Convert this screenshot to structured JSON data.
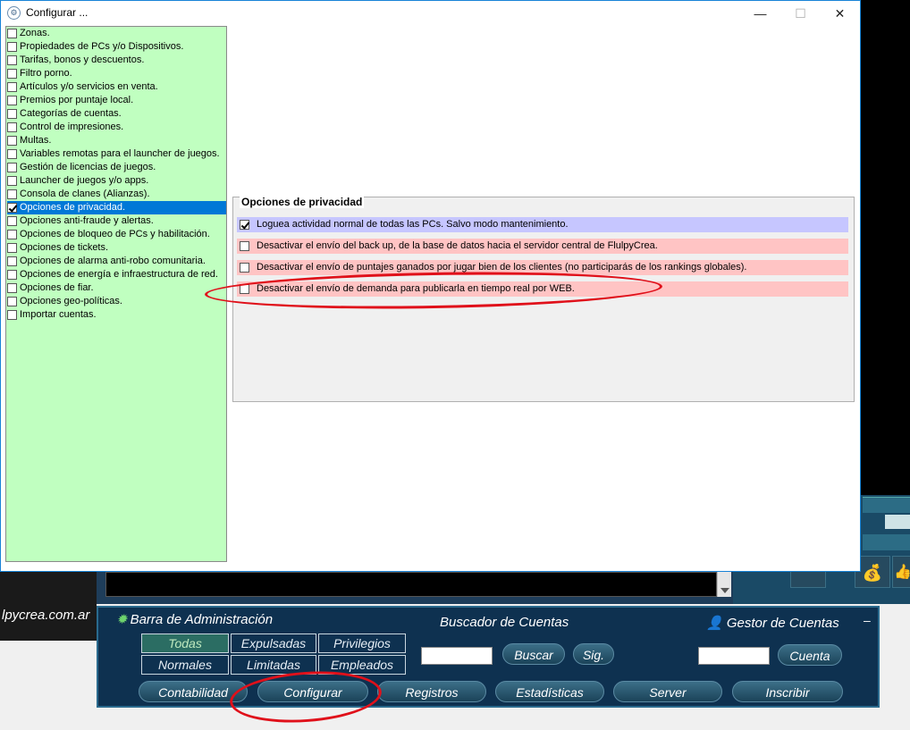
{
  "dialog": {
    "title": "Configurar ...",
    "window_buttons": {
      "minimize": "—",
      "maximize": "☐",
      "close": "✕"
    }
  },
  "tree": {
    "items": [
      {
        "label": "Zonas.",
        "checked": false,
        "selected": false
      },
      {
        "label": "Propiedades de PCs y/o Dispositivos.",
        "checked": false,
        "selected": false
      },
      {
        "label": "Tarifas, bonos y descuentos.",
        "checked": false,
        "selected": false
      },
      {
        "label": "Filtro porno.",
        "checked": false,
        "selected": false
      },
      {
        "label": "Artículos y/o servicios en venta.",
        "checked": false,
        "selected": false
      },
      {
        "label": "Premios por puntaje local.",
        "checked": false,
        "selected": false
      },
      {
        "label": "Categorías de cuentas.",
        "checked": false,
        "selected": false
      },
      {
        "label": "Control de impresiones.",
        "checked": false,
        "selected": false
      },
      {
        "label": "Multas.",
        "checked": false,
        "selected": false
      },
      {
        "label": "Variables remotas para el launcher de juegos.",
        "checked": false,
        "selected": false
      },
      {
        "label": "Gestión de licencias de juegos.",
        "checked": false,
        "selected": false
      },
      {
        "label": "Launcher de juegos y/o apps.",
        "checked": false,
        "selected": false
      },
      {
        "label": "Consola de clanes (Alianzas).",
        "checked": false,
        "selected": false
      },
      {
        "label": "Opciones de privacidad.",
        "checked": true,
        "selected": true
      },
      {
        "label": "Opciones anti-fraude y alertas.",
        "checked": false,
        "selected": false
      },
      {
        "label": "Opciones de bloqueo de PCs y habilitación.",
        "checked": false,
        "selected": false
      },
      {
        "label": "Opciones de tickets.",
        "checked": false,
        "selected": false
      },
      {
        "label": "Opciones de alarma anti-robo comunitaria.",
        "checked": false,
        "selected": false
      },
      {
        "label": "Opciones de energía e infraestructura de red.",
        "checked": false,
        "selected": false
      },
      {
        "label": "Opciones de fiar.",
        "checked": false,
        "selected": false
      },
      {
        "label": "Opciones geo-políticas.",
        "checked": false,
        "selected": false
      },
      {
        "label": "Importar cuentas.",
        "checked": false,
        "selected": false
      }
    ]
  },
  "privacy": {
    "group_title": "Opciones de privacidad",
    "options": [
      {
        "label": "Loguea actividad normal de todas las PCs. Salvo modo mantenimiento.",
        "checked": true,
        "tint": "blue"
      },
      {
        "label": "Desactivar el envío del back up, de la base de datos hacia el servidor central de FlulpyCrea.",
        "checked": false,
        "tint": "pink"
      },
      {
        "label": "Desactivar el envío de puntajes ganados por jugar bien de los clientes (no participarás de los rankings globales).",
        "checked": false,
        "tint": "pink"
      },
      {
        "label": "Desactivar el envío de demanda para publicarla en tiempo real por WEB.",
        "checked": false,
        "tint": "pink"
      }
    ]
  },
  "background": {
    "website": "lpycrea.com.ar",
    "admin_bar_title": "Barra de Administración",
    "search_title": "Buscador de Cuentas",
    "accounts_title": "Gestor de Cuentas",
    "minimize": "–",
    "filters": {
      "todas": "Todas",
      "expulsadas": "Expulsadas",
      "privilegios": "Privilegios",
      "normales": "Normales",
      "limitadas": "Limitadas",
      "empleados": "Empleados"
    },
    "buscar": "Buscar",
    "sig": "Sig.",
    "cuenta": "Cuenta",
    "bottom_buttons": {
      "contabilidad": "Contabilidad",
      "configurar": "Configurar",
      "registros": "Registros",
      "estadisticas": "Estadísticas",
      "server": "Server",
      "inscribir": "Inscribir"
    }
  },
  "colors": {
    "tree_bg": "#c0ffc0",
    "selected": "#0078d7",
    "option_blue": "#c6c6ff",
    "option_pink": "#ffc4c4",
    "annotation_red": "#e0101a",
    "admin_bg": "#0e3150"
  },
  "icons": [
    "config-app-icon",
    "gear-icon",
    "user-icon",
    "money-bag-icon",
    "thumb-icon"
  ]
}
